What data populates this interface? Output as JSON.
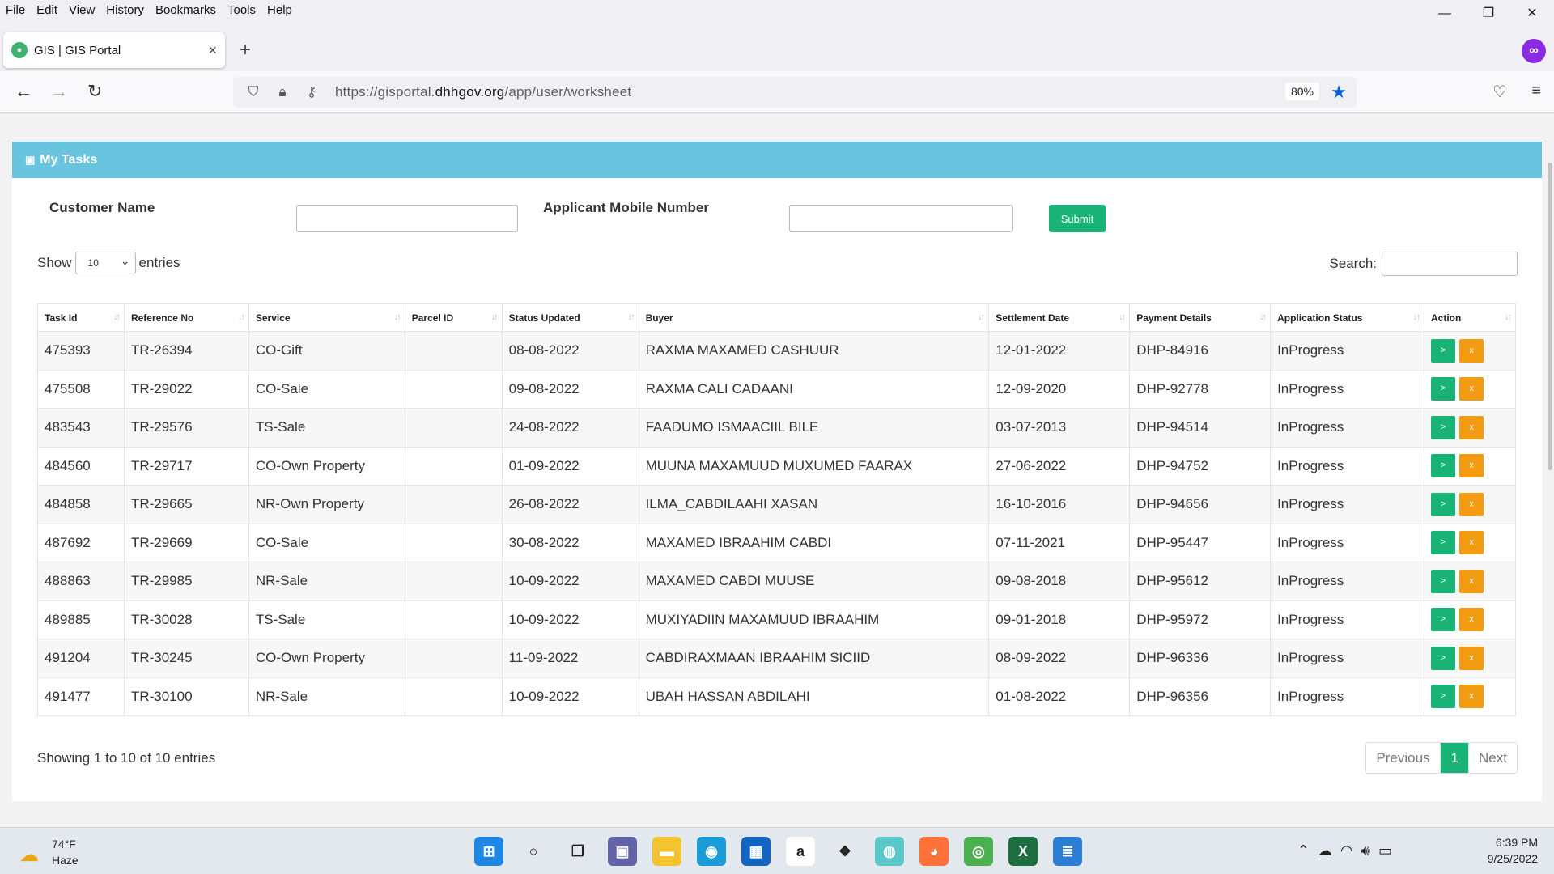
{
  "menu": [
    "File",
    "Edit",
    "View",
    "History",
    "Bookmarks",
    "Tools",
    "Help"
  ],
  "browser": {
    "tab_title": "GIS | GIS Portal",
    "url_prefix": "https://gisportal.",
    "url_domain": "dhhgov.org",
    "url_path": "/app/user/worksheet",
    "zoom": "80%"
  },
  "page": {
    "header": "My Tasks",
    "customer_name_label": "Customer Name",
    "mobile_label": "Applicant Mobile Number",
    "submit_label": "Submit",
    "show_label": "Show",
    "show_value": "10",
    "entries_label": "entries",
    "search_label": "Search:",
    "info": "Showing 1 to 10 of 10 entries",
    "prev": "Previous",
    "current_page": "1",
    "next": "Next"
  },
  "table": {
    "columns": [
      "Task Id",
      "Reference No",
      "Service",
      "Parcel ID",
      "Status Updated",
      "Buyer",
      "Settlement Date",
      "Payment Details",
      "Application Status",
      "Action"
    ],
    "action_go": ">",
    "action_x": "x",
    "rows": [
      [
        "475393",
        "TR-26394",
        "CO-Gift",
        "",
        "08-08-2022",
        "RAXMA MAXAMED CASHUUR",
        "12-01-2022",
        "DHP-84916",
        "InProgress"
      ],
      [
        "475508",
        "TR-29022",
        "CO-Sale",
        "",
        "09-08-2022",
        "RAXMA CALI CADAANI",
        "12-09-2020",
        "DHP-92778",
        "InProgress"
      ],
      [
        "483543",
        "TR-29576",
        "TS-Sale",
        "",
        "24-08-2022",
        "FAADUMO ISMAACIIL BILE",
        "03-07-2013",
        "DHP-94514",
        "InProgress"
      ],
      [
        "484560",
        "TR-29717",
        "CO-Own Property",
        "",
        "01-09-2022",
        "MUUNA MAXAMUUD MUXUMED FAARAX",
        "27-06-2022",
        "DHP-94752",
        "InProgress"
      ],
      [
        "484858",
        "TR-29665",
        "NR-Own Property",
        "",
        "26-08-2022",
        "ILMA_CABDILAAHI XASAN",
        "16-10-2016",
        "DHP-94656",
        "InProgress"
      ],
      [
        "487692",
        "TR-29669",
        "CO-Sale",
        "",
        "30-08-2022",
        "MAXAMED IBRAAHIM CABDI",
        "07-11-2021",
        "DHP-95447",
        "InProgress"
      ],
      [
        "488863",
        "TR-29985",
        "NR-Sale",
        "",
        "10-09-2022",
        "MAXAMED CABDI MUUSE",
        "09-08-2018",
        "DHP-95612",
        "InProgress"
      ],
      [
        "489885",
        "TR-30028",
        "TS-Sale",
        "",
        "10-09-2022",
        "MUXIYADIIN MAXAMUUD IBRAAHIM",
        "09-01-2018",
        "DHP-95972",
        "InProgress"
      ],
      [
        "491204",
        "TR-30245",
        "CO-Own Property",
        "",
        "11-09-2022",
        "CABDIRAXMAAN IBRAAHIM SICIID",
        "08-09-2022",
        "DHP-96336",
        "InProgress"
      ],
      [
        "491477",
        "TR-30100",
        "NR-Sale",
        "",
        "10-09-2022",
        "UBAH HASSAN ABDILAHI",
        "01-08-2022",
        "DHP-96356",
        "InProgress"
      ]
    ]
  },
  "taskbar": {
    "temp": "74°F",
    "weather": "Haze",
    "time": "6:39 PM",
    "date": "9/25/2022",
    "apps": [
      {
        "name": "start-icon",
        "color": "#1e88e5",
        "glyph": "⊞"
      },
      {
        "name": "search-icon",
        "color": "#e3e7ee",
        "glyph": "○"
      },
      {
        "name": "task-view-icon",
        "color": "#e3e7ee",
        "glyph": "❐"
      },
      {
        "name": "teams-chat-icon",
        "color": "#6264a7",
        "glyph": "▣"
      },
      {
        "name": "file-explorer-icon",
        "color": "#f4c430",
        "glyph": "▬"
      },
      {
        "name": "edge-icon",
        "color": "#1a9cd8",
        "glyph": "◉"
      },
      {
        "name": "store-icon",
        "color": "#1565c0",
        "glyph": "▦"
      },
      {
        "name": "amazon-icon",
        "color": "#ffffff",
        "glyph": "a"
      },
      {
        "name": "dropbox-icon",
        "color": "#e3e7ee",
        "glyph": "❖"
      },
      {
        "name": "messenger-icon",
        "color": "#5ac8c8",
        "glyph": "◍"
      },
      {
        "name": "firefox-icon",
        "color": "#ff7139",
        "glyph": "◕"
      },
      {
        "name": "chrome-icon",
        "color": "#4caf50",
        "glyph": "◎"
      },
      {
        "name": "excel-icon",
        "color": "#1d6f42",
        "glyph": "X"
      },
      {
        "name": "notepad-icon",
        "color": "#2d7fd3",
        "glyph": "≣"
      }
    ]
  }
}
